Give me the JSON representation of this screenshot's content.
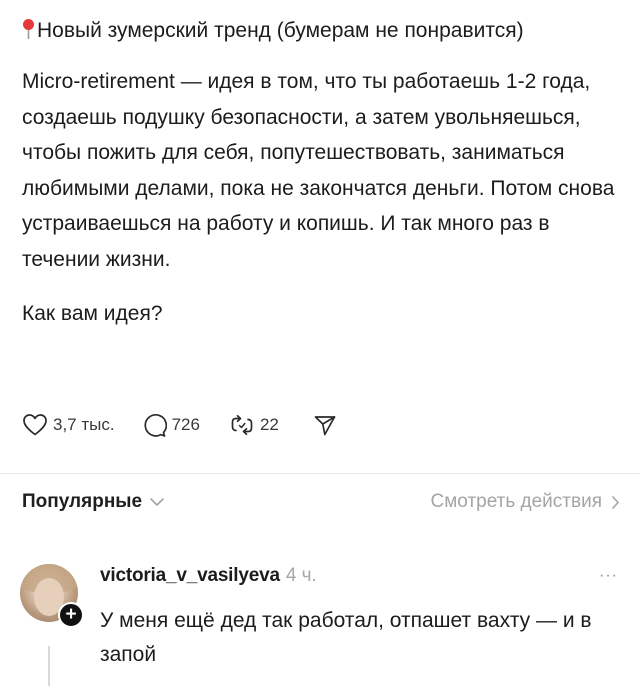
{
  "post": {
    "title_icon": "red-pin-icon",
    "title": "Новый зумерский тренд (бумерам не понравится)",
    "body_paragraph": "Micro-retirement — идея в том, что ты работаешь 1-2 года, создаешь подушку безопасности, а затем увольняешься, чтобы пожить для себя, попутешествовать, заниматься любимыми делами, пока не закончатся деньги. Потом снова устраиваешься на работу и копишь. И так много раз в течении жизни.",
    "question": "Как вам идея?"
  },
  "actions": {
    "likes": "3,7 тыс.",
    "comments": "726",
    "reposts": "22"
  },
  "sort_bar": {
    "sort_label": "Популярные",
    "view_activity_label": "Смотреть действия"
  },
  "comment": {
    "username": "victoria_v_vasilyeva",
    "time": "4 ч.",
    "more_label": "···",
    "follow_label": "+",
    "text": "У меня ещё дед так работал, отпашет вахту — и в запой"
  },
  "colors": {
    "pin": "#e63a3a",
    "text": "#1c1c1c",
    "muted": "#a5a5a5",
    "divider": "#e7e7e7"
  }
}
